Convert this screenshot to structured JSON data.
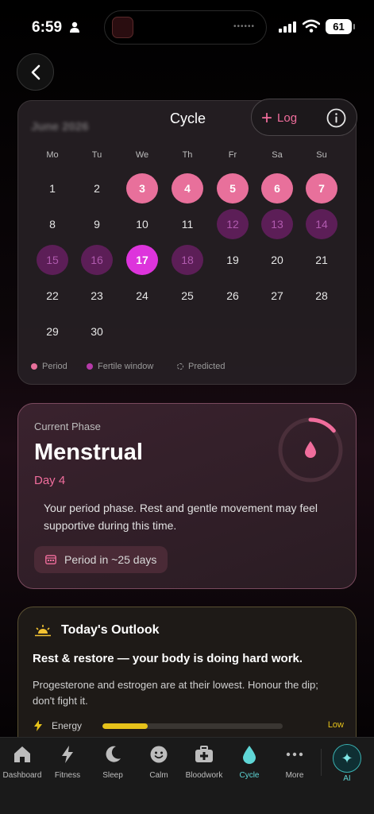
{
  "status_bar": {
    "time": "6:59",
    "battery": "61"
  },
  "calendar": {
    "month_label": "June 2026",
    "title": "Cycle",
    "weekdays": [
      "Mo",
      "Tu",
      "We",
      "Th",
      "Fr",
      "Sa",
      "Su"
    ],
    "days": [
      {
        "n": "1",
        "state": "normal"
      },
      {
        "n": "2",
        "state": "normal"
      },
      {
        "n": "3",
        "state": "period"
      },
      {
        "n": "4",
        "state": "period"
      },
      {
        "n": "5",
        "state": "period"
      },
      {
        "n": "6",
        "state": "period"
      },
      {
        "n": "7",
        "state": "period"
      },
      {
        "n": "8",
        "state": "normal"
      },
      {
        "n": "9",
        "state": "normal"
      },
      {
        "n": "10",
        "state": "normal"
      },
      {
        "n": "11",
        "state": "normal"
      },
      {
        "n": "12",
        "state": "fertile"
      },
      {
        "n": "13",
        "state": "fertile"
      },
      {
        "n": "14",
        "state": "fertile"
      },
      {
        "n": "15",
        "state": "fertile"
      },
      {
        "n": "16",
        "state": "fertile"
      },
      {
        "n": "17",
        "state": "today"
      },
      {
        "n": "18",
        "state": "fertile"
      },
      {
        "n": "19",
        "state": "normal"
      },
      {
        "n": "20",
        "state": "normal"
      },
      {
        "n": "21",
        "state": "normal"
      },
      {
        "n": "22",
        "state": "normal"
      },
      {
        "n": "23",
        "state": "normal"
      },
      {
        "n": "24",
        "state": "normal"
      },
      {
        "n": "25",
        "state": "normal"
      },
      {
        "n": "26",
        "state": "normal"
      },
      {
        "n": "27",
        "state": "normal"
      },
      {
        "n": "28",
        "state": "normal"
      },
      {
        "n": "29",
        "state": "normal"
      },
      {
        "n": "30",
        "state": "normal"
      }
    ],
    "legend": {
      "period": "Period",
      "fertile": "Fertile window",
      "predicted": "Predicted"
    }
  },
  "log_button": {
    "label": "Log"
  },
  "phase": {
    "label": "Current Phase",
    "name": "Menstrual",
    "day": "Day 4",
    "description": "Your period phase. Rest and gentle movement may feel supportive during this time.",
    "chip": "Period in ~25 days",
    "ring_progress": 0.14
  },
  "outlook": {
    "title": "Today's Outlook",
    "headline": "Rest & restore — your body is doing hard work.",
    "body": "Progesterone and estrogen are at their lowest. Honour the dip; don't fight it.",
    "energy_label": "Energy",
    "energy_value": "Low",
    "energy_level": 0.25
  },
  "tabs": [
    {
      "label": "Dashboard",
      "icon": "home-icon"
    },
    {
      "label": "Fitness",
      "icon": "bolt-icon"
    },
    {
      "label": "Sleep",
      "icon": "moon-icon"
    },
    {
      "label": "Calm",
      "icon": "smile-icon"
    },
    {
      "label": "Bloodwork",
      "icon": "medkit-icon"
    },
    {
      "label": "Cycle",
      "icon": "drop-icon"
    },
    {
      "label": "More",
      "icon": "more-icon"
    }
  ],
  "ai": {
    "label": "AI"
  },
  "colors": {
    "period": "#e8709b",
    "fertile": "#5c1e57",
    "today": "#dd34dc",
    "accent_teal": "#5fd6d6",
    "energy": "#e6c21a"
  }
}
